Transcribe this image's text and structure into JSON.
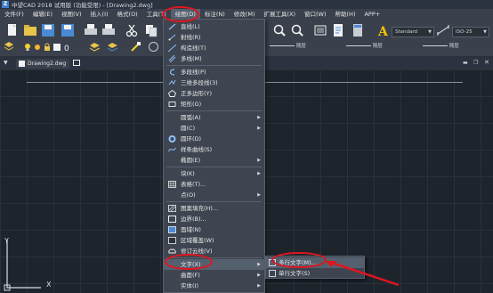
{
  "titlebar": {
    "app_icon": "Z",
    "title": "中望CAD 2018 试用版 (功能受限) - [Drawing2.dwg]"
  },
  "menubar": {
    "items": [
      "文件(F)",
      "编辑(E)",
      "视图(V)",
      "插入(I)",
      "格式(O)",
      "工具(T)",
      "绘图(D)",
      "标注(N)",
      "修改(M)",
      "扩展工具(X)",
      "窗口(W)",
      "帮助(H)",
      "APP+"
    ]
  },
  "toolbar": {
    "text_style": "Standard",
    "dim_style": "ISO-25",
    "layer_by": [
      "随层",
      "随层",
      "随层"
    ]
  },
  "tabs": {
    "doc": "Drawing2.dwg"
  },
  "draw_menu": {
    "items": [
      {
        "label": "直线(L)",
        "icon": "line-icon"
      },
      {
        "label": "射线(R)",
        "icon": "ray-icon"
      },
      {
        "label": "构造线(T)",
        "icon": "xline-icon"
      },
      {
        "label": "多线(M)",
        "icon": "mline-icon"
      },
      {
        "label": "多段线(P)",
        "icon": "polyline-icon"
      },
      {
        "label": "三维多段线(3)",
        "icon": "3dpoly-icon"
      },
      {
        "label": "正多边形(Y)",
        "icon": "polygon-icon"
      },
      {
        "label": "矩形(G)",
        "icon": "rectangle-icon"
      },
      {
        "label": "圆弧(A)",
        "icon": "",
        "submenu": true
      },
      {
        "label": "圆(C)",
        "icon": "",
        "submenu": true
      },
      {
        "label": "圆环(D)",
        "icon": "donut-icon"
      },
      {
        "label": "样条曲线(S)",
        "icon": "spline-icon"
      },
      {
        "label": "椭圆(E)",
        "icon": "",
        "submenu": true
      },
      {
        "label": "块(K)",
        "icon": "",
        "submenu": true
      },
      {
        "label": "表格(T)...",
        "icon": "table-icon"
      },
      {
        "label": "点(O)",
        "icon": "",
        "submenu": true
      },
      {
        "label": "图案填充(H)...",
        "icon": "hatch-icon"
      },
      {
        "label": "边界(B)...",
        "icon": "boundary-icon"
      },
      {
        "label": "面域(N)",
        "icon": "region-icon"
      },
      {
        "label": "区域覆盖(W)",
        "icon": "wipeout-icon"
      },
      {
        "label": "修订云线(V)",
        "icon": "revcloud-icon"
      },
      {
        "label": "文字(X)",
        "icon": "",
        "submenu": true
      },
      {
        "label": "曲面(F)",
        "icon": "",
        "submenu": true
      },
      {
        "label": "实体(I)",
        "icon": "",
        "submenu": true
      }
    ]
  },
  "text_submenu": {
    "items": [
      "多行文字(M)...",
      "单行文字(S)"
    ]
  },
  "ucs": {
    "x": "X",
    "y": "Y"
  },
  "colors": {
    "highlight_ring": "#e0151f",
    "menu_bg": "#3e4550",
    "canvas": "#1e242c"
  }
}
